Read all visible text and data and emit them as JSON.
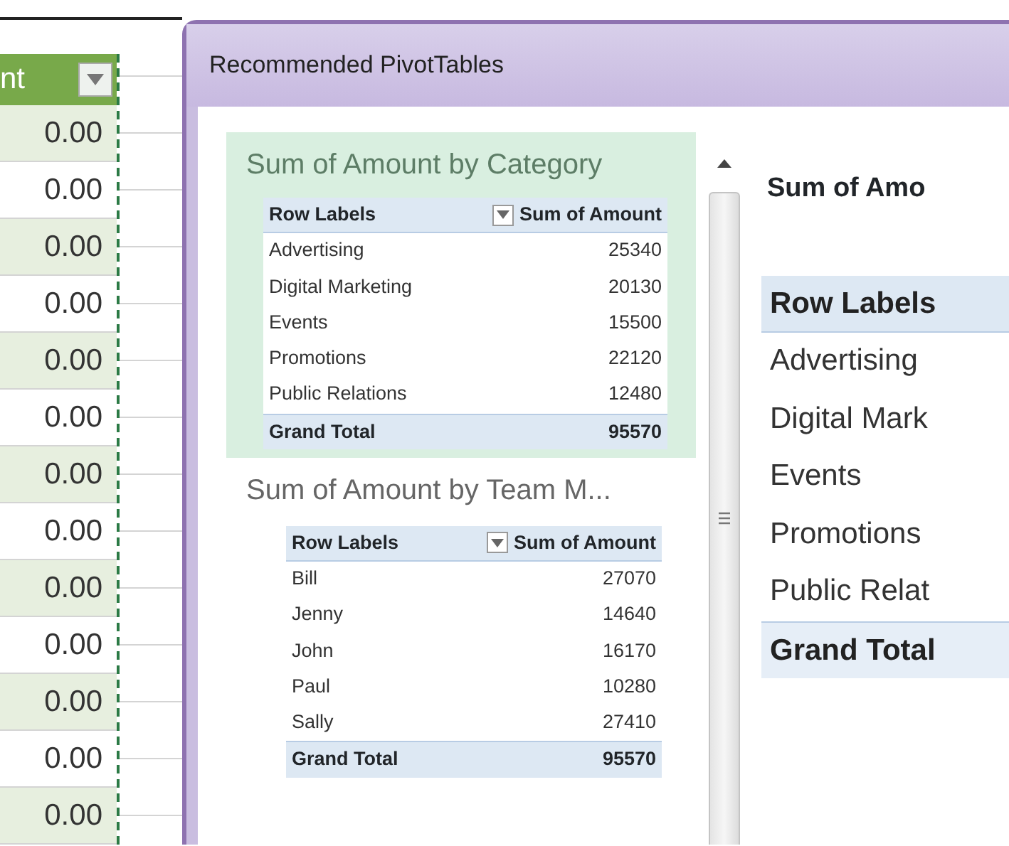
{
  "spreadsheet": {
    "column_header": "nt",
    "cells": [
      "0.00",
      "0.00",
      "0.00",
      "0.00",
      "0.00",
      "0.00",
      "0.00",
      "0.00",
      "0.00",
      "0.00",
      "0.00",
      "0.00",
      "0.00"
    ]
  },
  "dialog": {
    "title": "Recommended PivotTables",
    "recommendations": [
      {
        "title": "Sum of Amount by Category",
        "selected": true,
        "columns": [
          "Row Labels",
          "Sum of Amount"
        ],
        "rows": [
          [
            "Advertising",
            "25340"
          ],
          [
            "Digital Marketing",
            "20130"
          ],
          [
            "Events",
            "15500"
          ],
          [
            "Promotions",
            "22120"
          ],
          [
            "Public Relations",
            "12480"
          ]
        ],
        "total": [
          "Grand Total",
          "95570"
        ]
      },
      {
        "title": "Sum of Amount by Team M...",
        "selected": false,
        "columns": [
          "Row Labels",
          "Sum of Amount"
        ],
        "rows": [
          [
            "Bill",
            "27070"
          ],
          [
            "Jenny",
            "14640"
          ],
          [
            "John",
            "16170"
          ],
          [
            "Paul",
            "10280"
          ],
          [
            "Sally",
            "27410"
          ]
        ],
        "total": [
          "Grand Total",
          "95570"
        ]
      }
    ],
    "preview": {
      "title": "Sum of Amo",
      "header": "Row Labels",
      "rows": [
        "Advertising",
        "Digital Mark",
        "Events",
        "Promotions",
        "Public Relat"
      ],
      "total": "Grand Total"
    }
  }
}
